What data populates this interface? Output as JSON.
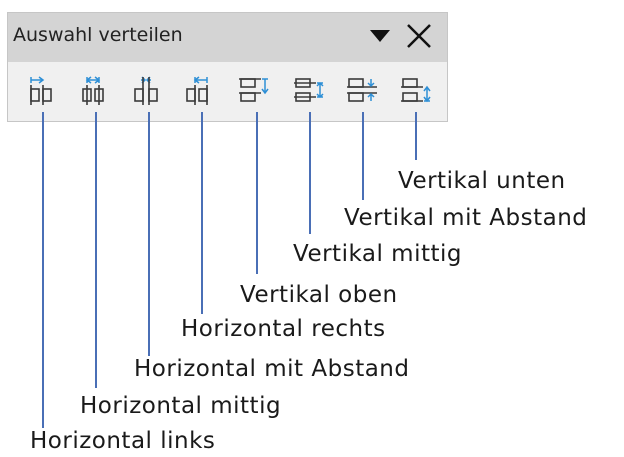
{
  "toolbar": {
    "title": "Auswahl verteilen",
    "menu_icon": "triangle-down-icon",
    "close_icon": "close-icon"
  },
  "buttons": [
    {
      "label": "Horizontal links",
      "icon": "distribute-horizontal-left-icon"
    },
    {
      "label": "Horizontal mittig",
      "icon": "distribute-horizontal-center-icon"
    },
    {
      "label": "Horizontal mit Abstand",
      "icon": "distribute-horizontal-spacing-icon"
    },
    {
      "label": "Horizontal rechts",
      "icon": "distribute-horizontal-right-icon"
    },
    {
      "label": "Vertikal oben",
      "icon": "distribute-vertical-top-icon"
    },
    {
      "label": "Vertikal mittig",
      "icon": "distribute-vertical-center-icon"
    },
    {
      "label": "Vertikal mit Abstand",
      "icon": "distribute-vertical-spacing-icon"
    },
    {
      "label": "Vertikal unten",
      "icon": "distribute-vertical-bottom-icon"
    }
  ],
  "colors": {
    "icon_dark": "#3b3b3b",
    "icon_accent": "#2e8fd6",
    "leader": "#4a6fb6"
  }
}
